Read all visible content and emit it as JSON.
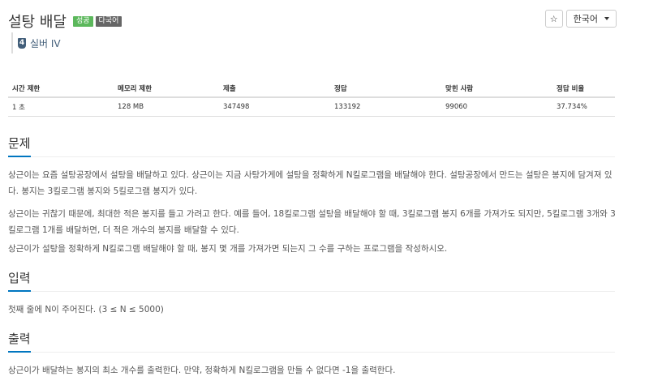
{
  "problem": {
    "title": "설탕 배달",
    "badges": {
      "success": "성공",
      "multilang": "다국어"
    },
    "tier": {
      "number": "4",
      "label": "실버 IV"
    }
  },
  "controls": {
    "star_icon": "☆",
    "language": "한국어"
  },
  "info_table": {
    "headers": [
      "시간 제한",
      "메모리 제한",
      "제출",
      "정답",
      "맞힌 사람",
      "정답 비율"
    ],
    "values": [
      "1 초",
      "128 MB",
      "347498",
      "133192",
      "99060",
      "37.734%"
    ]
  },
  "sections": {
    "problem": {
      "heading": "문제",
      "paragraphs": [
        "상근이는 요즘 설탕공장에서 설탕을 배달하고 있다. 상근이는 지금 사탕가게에 설탕을 정확하게 N킬로그램을 배달해야 한다. 설탕공장에서 만드는 설탕은 봉지에 담겨져 있다. 봉지는 3킬로그램 봉지와 5킬로그램 봉지가 있다.",
        "상근이는 귀찮기 때문에, 최대한 적은 봉지를 들고 가려고 한다. 예를 들어, 18킬로그램 설탕을 배달해야 할 때, 3킬로그램 봉지 6개를 가져가도 되지만, 5킬로그램 3개와 3킬로그램 1개를 배달하면, 더 적은 개수의 봉지를 배달할 수 있다.",
        "상근이가 설탕을 정확하게 N킬로그램 배달해야 할 때, 봉지 몇 개를 가져가면 되는지 그 수를 구하는 프로그램을 작성하시오."
      ]
    },
    "input": {
      "heading": "입력",
      "text": "첫째 줄에 N이 주어진다. (3 ≤ N ≤ 5000)"
    },
    "output": {
      "heading": "출력",
      "text": "상근이가 배달하는 봉지의 최소 개수를 출력한다. 만약, 정확하게 N킬로그램을 만들 수 없다면 -1을 출력한다."
    }
  },
  "colors": {
    "accent": "#0076c0",
    "success": "#5cb85c",
    "tier": "#435f7a"
  }
}
